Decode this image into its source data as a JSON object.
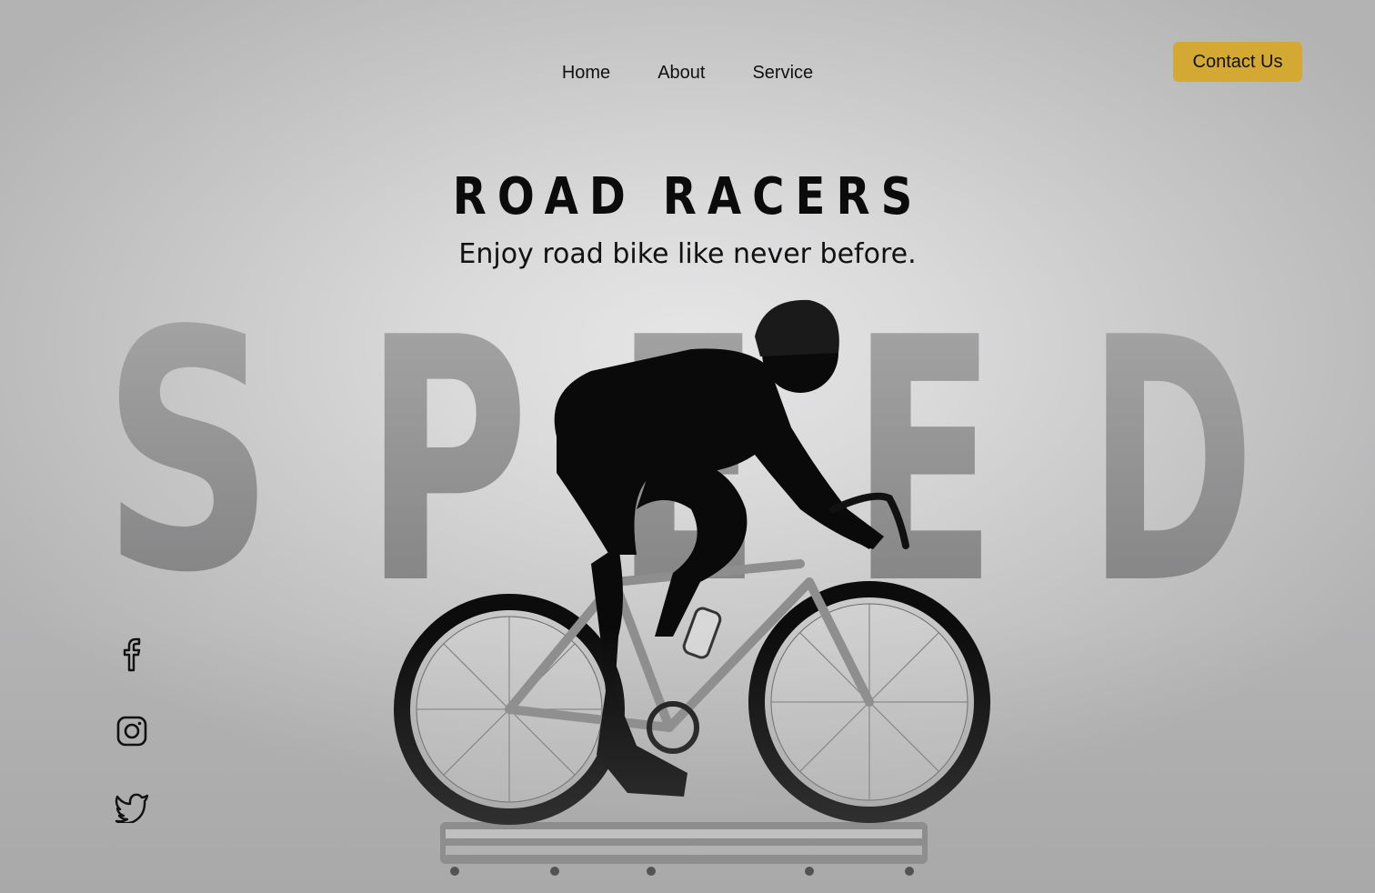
{
  "nav": {
    "items": [
      {
        "label": "Home"
      },
      {
        "label": "About"
      },
      {
        "label": "Service"
      }
    ],
    "contact_label": "Contact Us"
  },
  "hero": {
    "title": "ROAD RACERS",
    "subtitle": "Enjoy road bike like never before.",
    "background_word": "SPEED"
  },
  "social": [
    {
      "icon": "facebook-icon"
    },
    {
      "icon": "instagram-icon"
    },
    {
      "icon": "twitter-icon"
    }
  ],
  "colors": {
    "accent": "#d4a933",
    "text": "#111111"
  }
}
